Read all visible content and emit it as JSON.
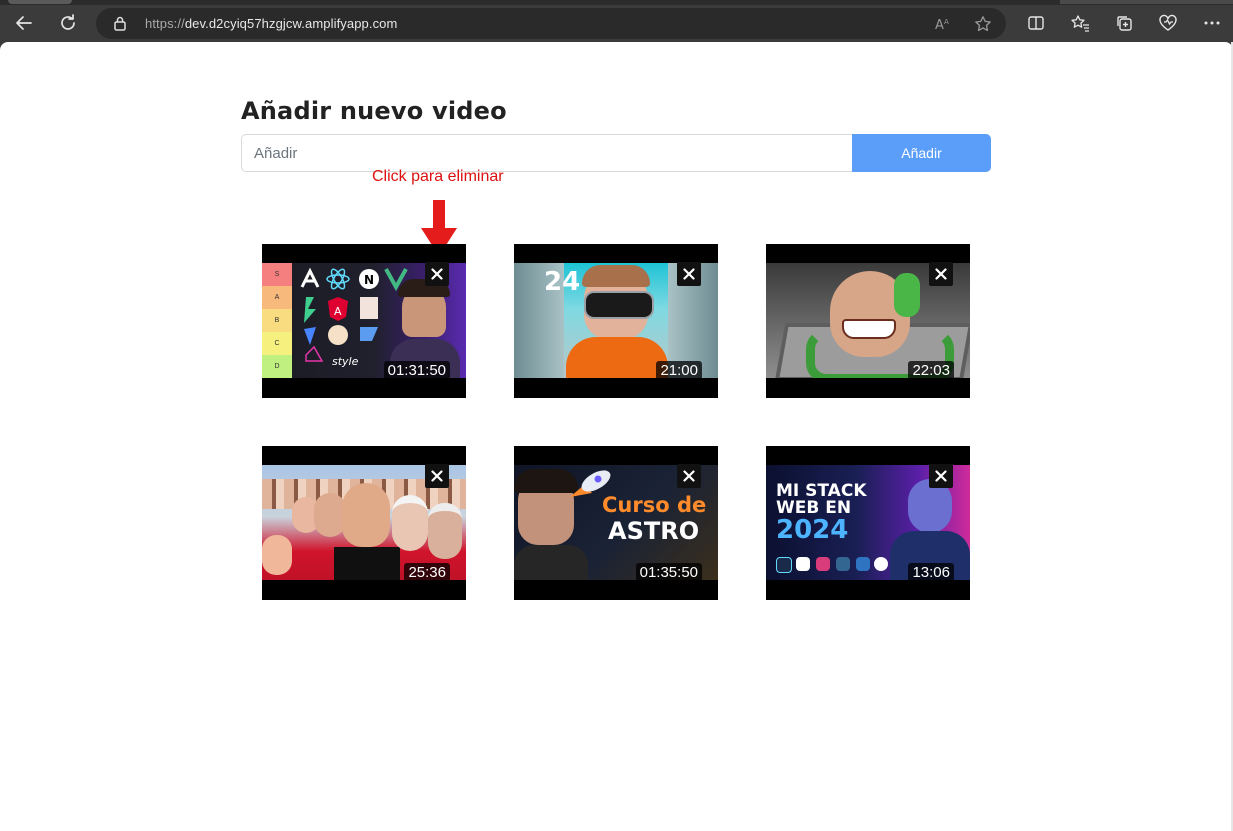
{
  "browser": {
    "url_protocol": "https://",
    "url_host": "dev.d2cyiq57hzgjcw.amplifyapp.com"
  },
  "form": {
    "title": "Añadir nuevo video",
    "input_placeholder": "Añadir",
    "input_value": "",
    "button_label": "Añadir"
  },
  "annotation": {
    "text": "Click para eliminar",
    "color": "#dd1111"
  },
  "videos": [
    {
      "duration": "01:31:50"
    },
    {
      "duration": "21:00",
      "thumb_text": "24 HO"
    },
    {
      "duration": "22:03"
    },
    {
      "duration": "25:36"
    },
    {
      "duration": "01:35:50",
      "thumb_text_1": "Curso de",
      "thumb_text_2": "ASTRO"
    },
    {
      "duration": "13:06",
      "thumb_text_1": "MI STACK",
      "thumb_text_2": "WEB EN",
      "thumb_text_3": "2024"
    }
  ],
  "colors": {
    "accent": "#5b9ef9",
    "chrome": "#3b3b3b",
    "address_bar": "#2a2a2a"
  },
  "icons": {
    "close": "close-icon",
    "back": "back-arrow-icon",
    "refresh": "refresh-icon",
    "lock": "lock-icon"
  }
}
